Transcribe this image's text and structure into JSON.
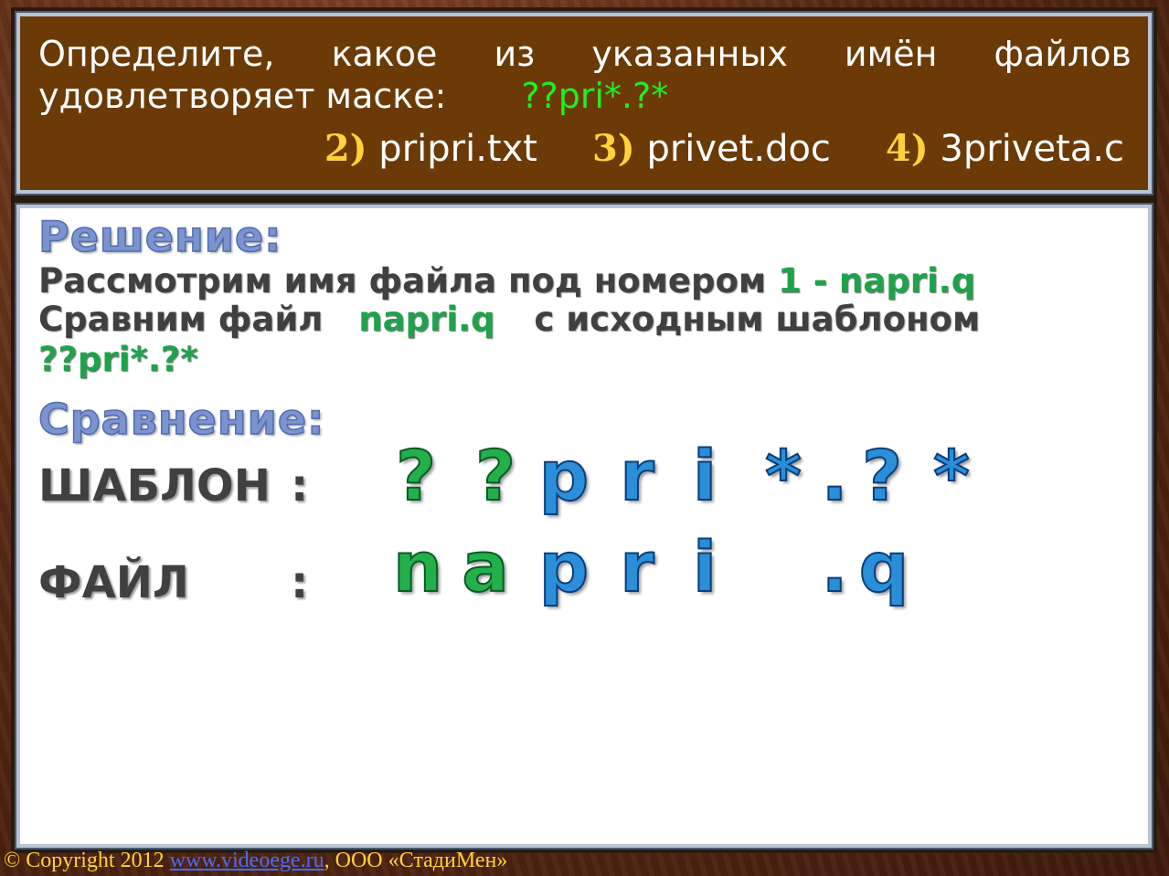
{
  "task": {
    "line1_words": [
      "Определите,",
      "какое",
      "из",
      "указанных",
      "имён",
      "файлов"
    ],
    "line2_text": "удовлетворяет маске:",
    "mask": "??pri*.?*",
    "options": [
      {
        "num": "2)",
        "name": "pripri.txt"
      },
      {
        "num": "3)",
        "name": "privet.doc"
      },
      {
        "num": "4)",
        "name": "3priveta.c"
      }
    ]
  },
  "solution": {
    "heading": "Решение:",
    "line1_text": "Рассмотрим имя файла под номером",
    "line1_highlight": "1 - napri.q",
    "line2_text": "Сравним файл",
    "line2_highlight": "napri.q",
    "line2_tail": "с исходным шаблоном",
    "line3_mask": "??pri*.?*",
    "comparison_heading": "Сравнение:",
    "template_label": "ШАБЛОН",
    "file_label": "ФАЙЛ",
    "colon": ":",
    "template_symbols": [
      "?",
      "?",
      "p",
      "r",
      "i",
      "*",
      ".",
      "?",
      "*"
    ],
    "file_symbols": [
      "n",
      "a",
      "p",
      "r",
      "i",
      ".",
      "q"
    ]
  },
  "footer": {
    "copyright": "© Copyright 2012",
    "link": "www.videoege.ru",
    "company": ", ООО «СтадиМен»"
  }
}
